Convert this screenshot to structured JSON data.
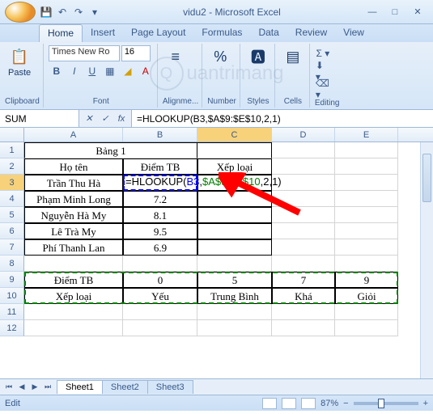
{
  "window": {
    "title": "vidu2 - Microsoft Excel"
  },
  "ribbon": {
    "tabs": [
      "Home",
      "Insert",
      "Page Layout",
      "Formulas",
      "Data",
      "Review",
      "View"
    ],
    "active_tab": "Home",
    "groups": {
      "clipboard": {
        "label": "Clipboard",
        "paste": "Paste"
      },
      "font": {
        "label": "Font",
        "family": "Times New Ro",
        "size": "16"
      },
      "alignment": {
        "label": "Alignme..."
      },
      "number": {
        "label": "Number"
      },
      "styles": {
        "label": "Styles"
      },
      "cells": {
        "label": "Cells"
      },
      "editing": {
        "label": "Editing"
      }
    }
  },
  "formula_bar": {
    "name_box": "SUM",
    "formula": "=HLOOKUP(B3,$A$9:$E$10,2,1)"
  },
  "columns": [
    "A",
    "B",
    "C",
    "D",
    "E"
  ],
  "grid": {
    "r1": {
      "A": "Bảng 1"
    },
    "r2": {
      "A": "Họ tên",
      "B": "Điểm TB",
      "C": "Xếp loại"
    },
    "r3": {
      "A": "Trần Thu Hà",
      "B_formula_parts": [
        "=HLOOKUP(",
        "B3",
        ",",
        "$A$9:$E$10",
        ",2,1)"
      ]
    },
    "r4": {
      "A": "Phạm Minh Long",
      "B": "7.2"
    },
    "r5": {
      "A": "Nguyễn Hà My",
      "B": "8.1"
    },
    "r6": {
      "A": "Lê Trà My",
      "B": "9.5"
    },
    "r7": {
      "A": "Phí Thanh Lan",
      "B": "6.9"
    },
    "r9": {
      "A": "Điểm TB",
      "B": "0",
      "C": "5",
      "D": "7",
      "E": "9"
    },
    "r10": {
      "A": "Xếp loại",
      "B": "Yếu",
      "C": "Trung Bình",
      "D": "Khá",
      "E": "Giỏi"
    }
  },
  "sheets": {
    "tabs": [
      "Sheet1",
      "Sheet2",
      "Sheet3"
    ],
    "active": "Sheet1"
  },
  "status": {
    "mode": "Edit",
    "zoom": "87%"
  }
}
